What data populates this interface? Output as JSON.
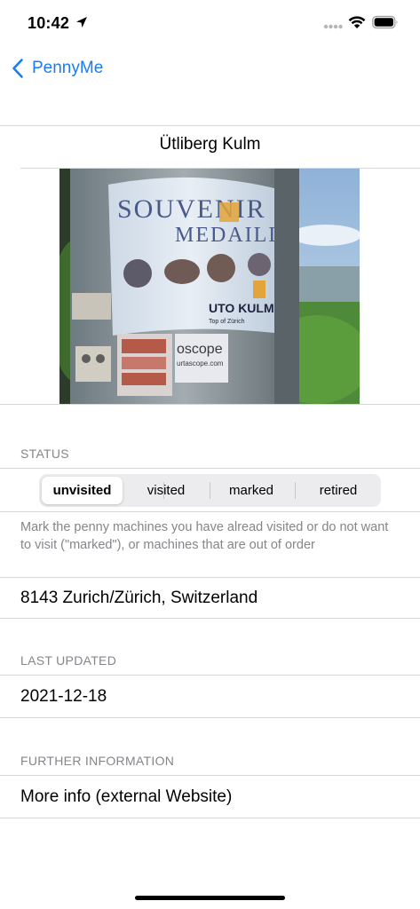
{
  "status_bar": {
    "time": "10:42",
    "icons": [
      "location-arrow-icon",
      "signal-dots-icon",
      "wifi-icon",
      "battery-icon"
    ]
  },
  "nav": {
    "back_label": "PennyMe",
    "accent_color": "#1a7cf3"
  },
  "machine": {
    "title": "Ütliberg Kulm",
    "photo": {
      "sign_text_line1": "SOUVENIR",
      "sign_text_line2": "MEDAILLE",
      "brand": "UTO KULM",
      "brand_sub": "Top of Zürich",
      "sponsor": "oscope",
      "sponsor_url": "urtascope.com"
    }
  },
  "status_section": {
    "header": "STATUS",
    "options": [
      "unvisited",
      "visited",
      "marked",
      "retired"
    ],
    "selected": "unvisited",
    "footnote": "Mark the penny machines you have alread visited or do not want to visit (\"marked\"), or machines that are out of order"
  },
  "address": "8143 Zurich/Zürich, Switzerland",
  "last_updated": {
    "header": "LAST UPDATED",
    "value": "2021-12-18"
  },
  "further_info": {
    "header": "FURTHER INFORMATION",
    "link_label": "More info (external Website)"
  }
}
